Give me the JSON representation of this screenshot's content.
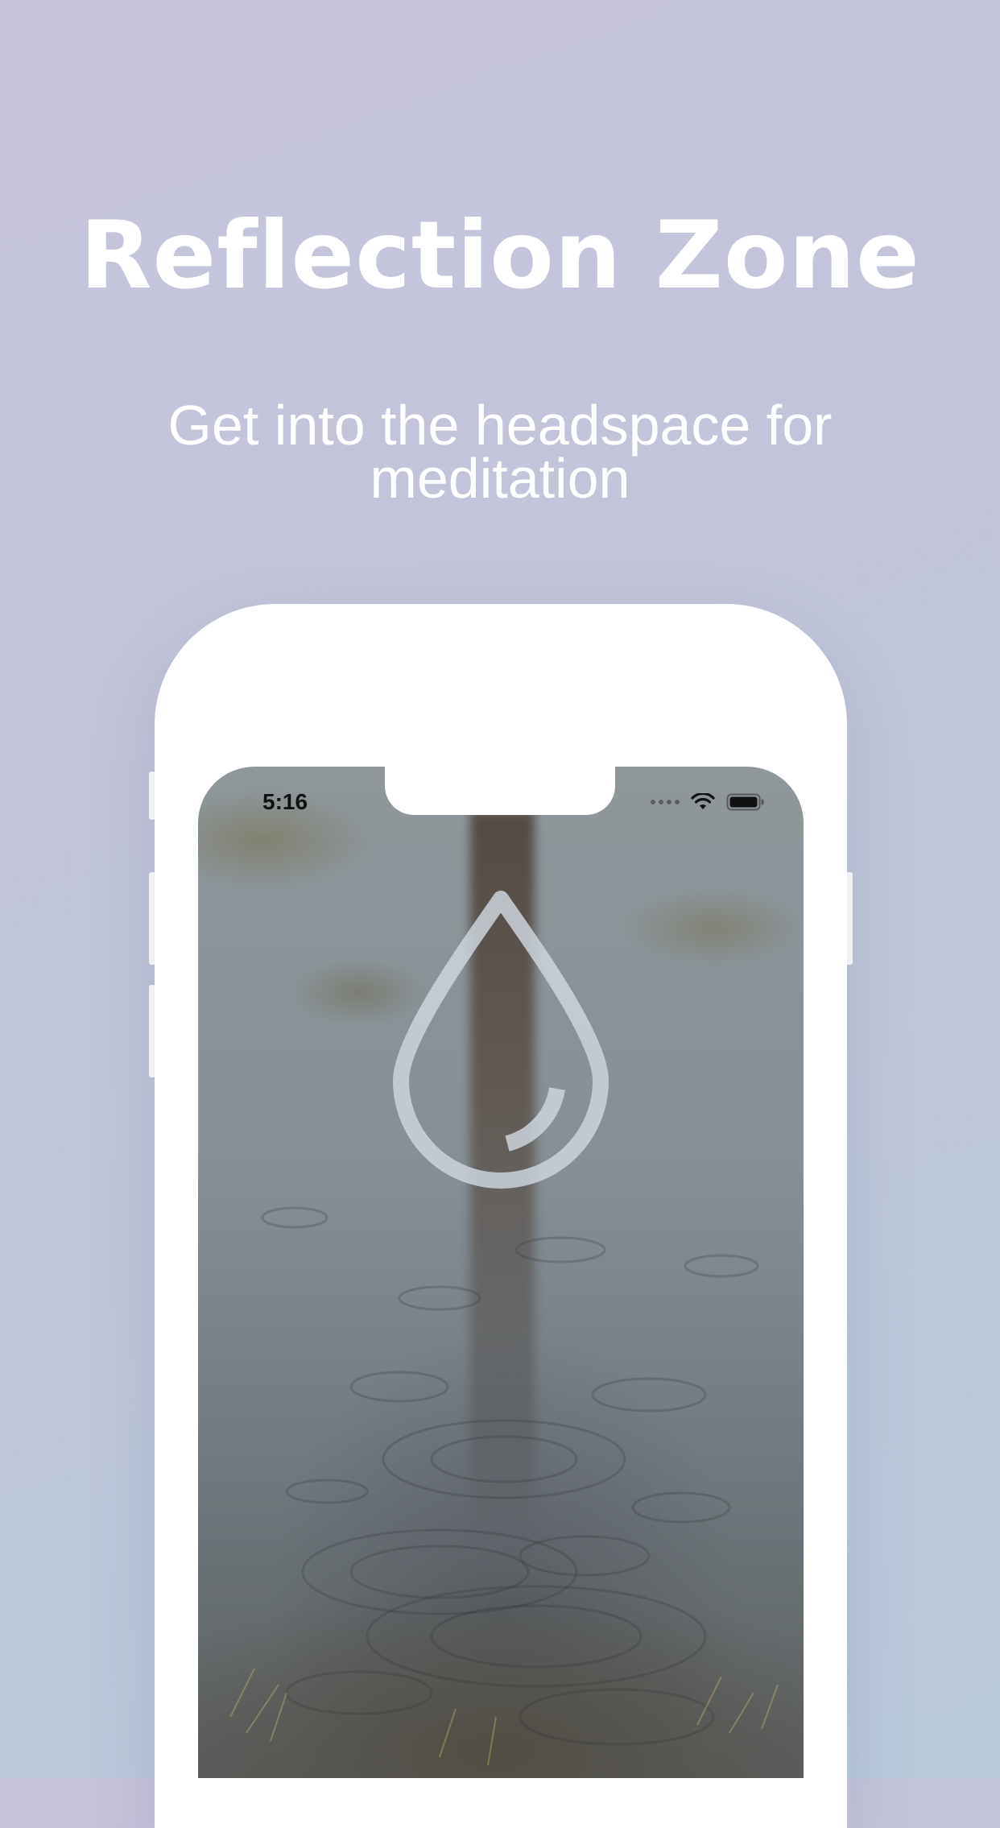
{
  "header": {
    "title": "Reflection Zone",
    "subtitle": "Get into the headspace for meditation"
  },
  "device": {
    "status_bar": {
      "time": "5:16",
      "icons": [
        "cellular-signal-icon",
        "wifi-icon",
        "battery-icon"
      ]
    },
    "screen": {
      "logo": "water-drop-icon",
      "background": "rain-puddle-photo"
    }
  },
  "colors": {
    "background_top": "#c6c3da",
    "background_bottom": "#b9c9da",
    "text": "#ffffff",
    "device_frame": "#ffffff"
  }
}
